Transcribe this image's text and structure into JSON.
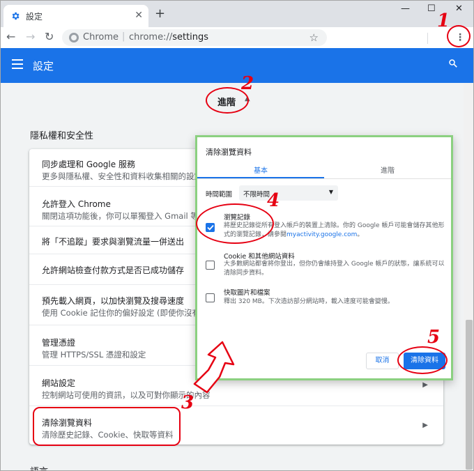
{
  "window": {
    "tab_title": "設定",
    "tab_close": "✕",
    "new_tab": "+",
    "minimize": "—",
    "maximize": "☐",
    "close": "✕"
  },
  "toolbar": {
    "back": "←",
    "forward": "→",
    "reload": "↻",
    "host_label": "Chrome",
    "separator": "|",
    "url_scheme": "chrome://",
    "url_path": "settings",
    "star": "☆",
    "menu": "⋮"
  },
  "appbar": {
    "title": "設定"
  },
  "content": {
    "advanced_label": "進階",
    "advanced_arrow": "▲",
    "section_title": "隱私權和安全性",
    "bottom_heading": "語言",
    "rows": [
      {
        "title": "同步處理和 Google 服務",
        "subtitle": "更多與隱私權、安全性和資料收集相關的設定"
      },
      {
        "title": "允許登入 Chrome",
        "subtitle": "關閉這項功能後，你可以單獨登入 Gmail 等"
      },
      {
        "title": "將「不追蹤」要求與瀏覽流量一併送出",
        "subtitle": ""
      },
      {
        "title": "允許網站檢查付款方式是否已成功儲存",
        "subtitle": ""
      },
      {
        "title": "預先載入網頁，以加快瀏覽及搜尋速度",
        "subtitle": "使用 Cookie 記住你的偏好設定 (即使你沒有"
      },
      {
        "title": "管理憑證",
        "subtitle": "管理 HTTPS/SSL 憑證和設定"
      },
      {
        "title": "網站設定",
        "subtitle": "控制網站可使用的資訊，以及可對你顯示的內容"
      },
      {
        "title": "清除瀏覽資料",
        "subtitle": "清除歷史記錄、Cookie、快取等資料"
      }
    ],
    "row_arrow": "▶"
  },
  "dialog": {
    "title": "清除瀏覽資料",
    "tab_basic": "基本",
    "tab_advanced": "進階",
    "time_range_label": "時間範圍",
    "time_range_value": "不限時間",
    "time_range_caret": "▼",
    "options": [
      {
        "title": "瀏覽記錄",
        "desc": "將歷史記錄從所有登入帳戶的裝置上清除。你的 Google 帳戶可能會儲存其他形式的瀏覽記錄，請參閱",
        "link": "myactivity.google.com",
        "desc_end": "。",
        "checked": true
      },
      {
        "title": "Cookie 和其他網站資料",
        "desc": "大多數網站都會將你登出，但你仍會維持登入 Google 帳戶的狀態，讓系統可以清除同步資料。",
        "checked": false
      },
      {
        "title": "快取圖片和檔案",
        "desc": "釋出 320 MB。下次造訪部分網站時，載入速度可能會變慢。",
        "checked": false
      }
    ],
    "cancel_label": "取消",
    "clear_label": "清除資料"
  },
  "annotations": {
    "step1": "1",
    "step2": "2",
    "step3": "3",
    "step4": "4",
    "step5": "5",
    "accent": "#e60012"
  },
  "colors": {
    "brand": "#1a73e8",
    "dialog_border": "#8bd080"
  }
}
